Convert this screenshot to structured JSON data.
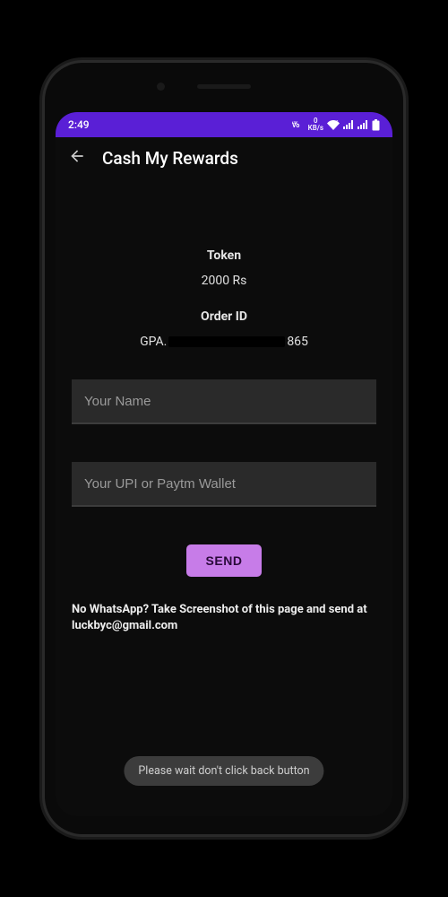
{
  "status": {
    "time": "2:49",
    "kbps": "0",
    "kbps_unit": "KB/s"
  },
  "appbar": {
    "title": "Cash My Rewards"
  },
  "token": {
    "label": "Token",
    "value": "2000 Rs"
  },
  "order": {
    "label": "Order ID",
    "prefix": "GPA.",
    "suffix": "865"
  },
  "inputs": {
    "name_placeholder": "Your Name",
    "upi_placeholder": "Your UPI or Paytm Wallet"
  },
  "buttons": {
    "send": "SEND"
  },
  "footer": {
    "help": "No WhatsApp? Take Screenshot of this page and send at luckbyc@gmail.com"
  },
  "toast": {
    "message": "Please wait don't click back button"
  }
}
